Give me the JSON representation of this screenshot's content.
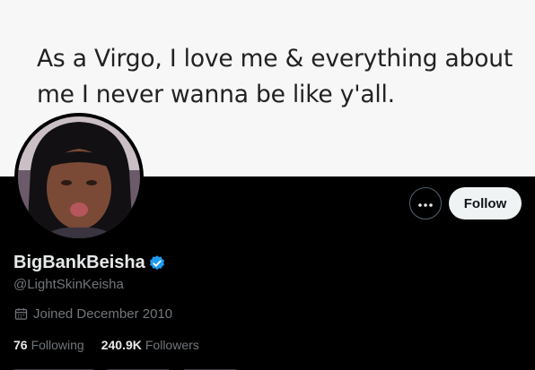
{
  "banner": {
    "text": "As a Virgo, I love me & everything about me I never wanna be like y'all."
  },
  "profile": {
    "display_name": "BigBankBeisha",
    "handle": "@LightSkinKeisha",
    "verified": true,
    "joined": "Joined December 2010",
    "follow_label": "Follow",
    "stats": {
      "following_count": "76",
      "following_label": "Following",
      "followers_count": "240.9K",
      "followers_label": "Followers"
    }
  },
  "icons": {
    "more": "more-dots-icon",
    "verified": "verified-badge-icon",
    "calendar": "calendar-icon"
  },
  "colors": {
    "background": "#000000",
    "banner_bg": "#f7f7f7",
    "verified_blue": "#1d9bf0",
    "muted_text": "#71767b",
    "follow_button_bg": "#eff3f4"
  }
}
